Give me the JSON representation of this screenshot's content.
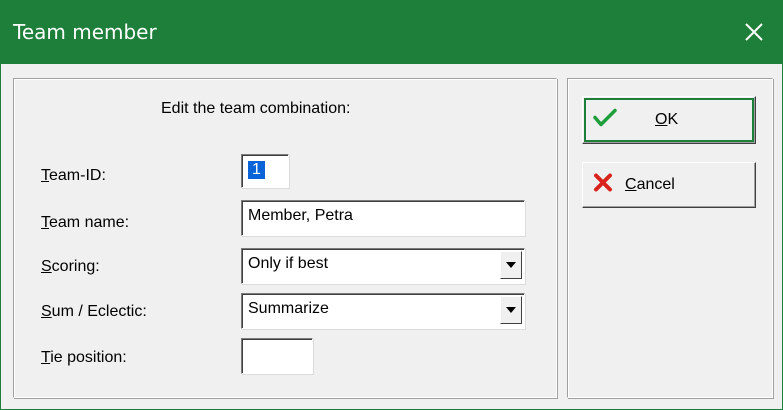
{
  "window": {
    "title": "Team member",
    "close_icon": "close-icon"
  },
  "form": {
    "heading": "Edit the team combination:",
    "team_id": {
      "label_key": "T",
      "label_rest": "eam-ID:",
      "value": "1"
    },
    "team_name": {
      "label_key": "T",
      "label_rest": "eam name:",
      "value": "Member, Petra"
    },
    "scoring": {
      "label_key": "S",
      "label_rest": "coring:",
      "value": "Only if best"
    },
    "sum_eclectic": {
      "label_key": "S",
      "label_rest": "um / Eclectic:",
      "value": "Summarize"
    },
    "tie_position": {
      "label_key": "T",
      "label_rest": "ie position:",
      "value": ""
    }
  },
  "buttons": {
    "ok": {
      "label_key": "O",
      "label_rest": "K",
      "icon": "checkmark-icon",
      "icon_color": "#1e9f3a"
    },
    "cancel": {
      "label_key": "C",
      "label_rest": "ancel",
      "icon": "x-icon",
      "icon_color": "#d9231c"
    }
  },
  "colors": {
    "titlebar": "#1e7f3a",
    "selection": "#0a64d8"
  }
}
